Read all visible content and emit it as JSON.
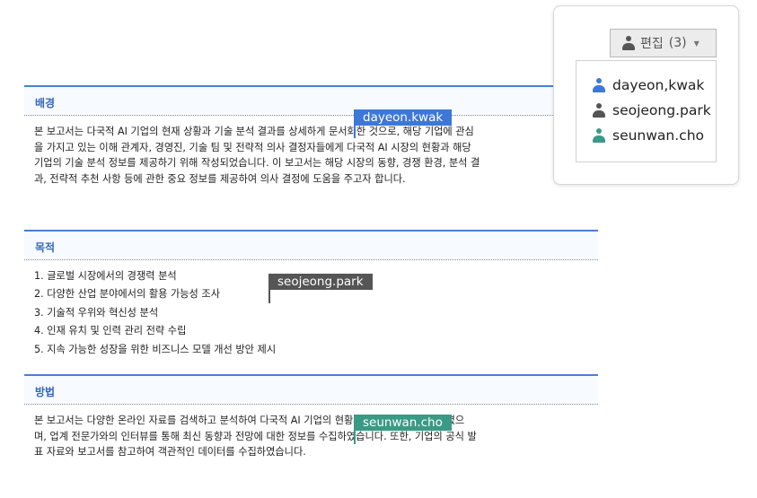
{
  "sections": [
    {
      "heading": "배경",
      "lines": [
        "본 보고서는 다국적 AI 기업의 현재 상황과 기술 분석 결과를 상세하게 문서화한 것으로, 해당 기업에 관심",
        "을 가지고 있는 이해 관계자, 경영진, 기술 팀 및 전략적 의사 결정자들에게 다국적 AI 시장의 현황과 해당",
        "기업의 기술 분석 정보를 제공하기 위해 작성되었습니다. 이 보고서는 해당 시장의 동향, 경쟁 환경, 분석 결",
        "과, 전략적 추천 사항 등에 관한 중요 정보를 제공하여 의사 결정에 도움을 주고자 합니다."
      ]
    },
    {
      "heading": "목적",
      "items": [
        "1. 글로벌 시장에서의 경쟁력 분석",
        "2. 다양한 산업 분야에서의 활용 가능성 조사",
        "3. 기술적 우위와 혁신성 분석",
        "4. 인재 유치 및 인력 관리 전략 수립",
        "5. 지속 가능한 성장을 위한 비즈니스 모델 개선 방안 제시"
      ]
    },
    {
      "heading": "방법",
      "lines": [
        "본 보고서는 다양한 온라인 자료를 검색하고 분석하여 다국적 AI 기업의 현황과 성장 전략을 파악하였으",
        "며, 업계 전문가와의 인터뷰를 통해 최신 동향과 전망에 대한 정보를 수집하였습니다. 또한, 기업의 공식 발",
        "표 자료와 보고서를 참고하여 객관적인 데이터를 수집하였습니다."
      ]
    }
  ],
  "cursors": [
    {
      "name": "dayeon.kwak",
      "color": "#3d78d8"
    },
    {
      "name": "seojeong.park",
      "color": "#555555"
    },
    {
      "name": "seunwan.cho",
      "color": "#3a9a86"
    }
  ],
  "edit_button": {
    "label": "편집",
    "count": "(3)"
  },
  "users": [
    {
      "name": "dayeon,kwak",
      "color": "#3d78d8"
    },
    {
      "name": "seojeong.park",
      "color": "#555555"
    },
    {
      "name": "seunwan.cho",
      "color": "#3a9a86"
    }
  ],
  "icons": {
    "user": "user-icon",
    "dropdown": "chevron-down-icon"
  }
}
